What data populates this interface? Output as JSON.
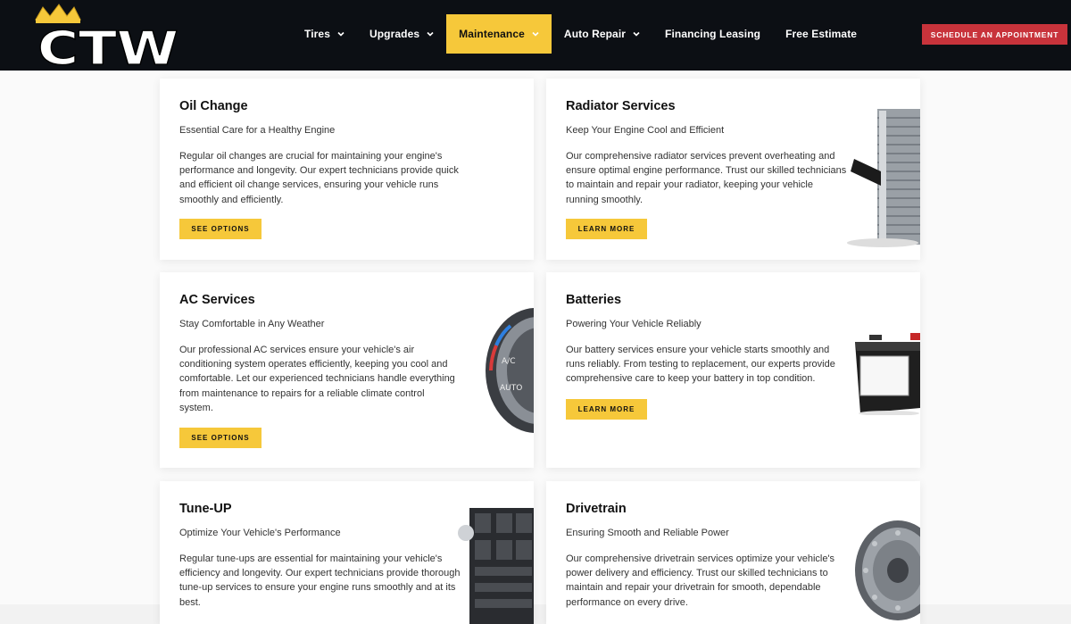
{
  "header": {
    "logo_text": "CTW",
    "nav": [
      {
        "label": "Tires",
        "dropdown": true
      },
      {
        "label": "Upgrades",
        "dropdown": true
      },
      {
        "label": "Maintenance",
        "dropdown": true,
        "active": true
      },
      {
        "label": "Auto Repair",
        "dropdown": true
      },
      {
        "label": "Financing Leasing",
        "dropdown": false
      },
      {
        "label": "Free Estimate",
        "dropdown": false
      }
    ],
    "cta_label": "SCHEDULE AN APPOINTMENT"
  },
  "colors": {
    "header_bg": "#0c0f14",
    "accent_yellow": "#f6c83a",
    "cta_red": "#c8333b"
  },
  "services": [
    {
      "title": "Oil Change",
      "subtitle": "Essential Care for a Healthy Engine",
      "description": "Regular oil changes are crucial for maintaining your engine's performance and longevity. Our expert technicians provide quick and efficient oil change services, ensuring your vehicle runs smoothly and efficiently.",
      "button": "SEE OPTIONS",
      "image_icon": "oil-bottle-icon"
    },
    {
      "title": "Radiator Services",
      "subtitle": "Keep Your Engine Cool and Efficient",
      "description": "Our comprehensive radiator services prevent overheating and ensure optimal engine performance. Trust our skilled technicians to maintain and repair your radiator, keeping your vehicle running smoothly.",
      "button": "LEARN MORE",
      "image_icon": "radiator-icon"
    },
    {
      "title": "AC Services",
      "subtitle": "Stay Comfortable in Any Weather",
      "description": "Our professional AC services ensure your vehicle's air conditioning system operates efficiently, keeping you cool and comfortable. Let our experienced technicians handle everything from maintenance to repairs for a reliable climate control system.",
      "button": "SEE OPTIONS",
      "image_icon": "ac-control-knob-icon",
      "knob_labels": [
        "A/C",
        "AUTO"
      ]
    },
    {
      "title": "Batteries",
      "subtitle": "Powering Your Vehicle Reliably",
      "description": "Our battery services ensure your vehicle starts smoothly and runs reliably. From testing to replacement, our experts provide comprehensive care to keep your battery in top condition.",
      "button": "LEARN MORE",
      "image_icon": "car-battery-icon"
    },
    {
      "title": "Tune-UP",
      "subtitle": "Optimize Your Vehicle's Performance",
      "description": "Regular tune-ups are essential for maintaining your vehicle's efficiency and longevity. Our expert technicians provide thorough tune-up services to ensure your engine runs smoothly and at its best.",
      "button": "SEE OPTIONS",
      "image_icon": "engine-icon"
    },
    {
      "title": "Drivetrain",
      "subtitle": "Ensuring Smooth and Reliable Power",
      "description": "Our comprehensive drivetrain services optimize your vehicle's power delivery and efficiency. Trust our skilled technicians to maintain and repair your drivetrain for smooth, dependable performance on every drive.",
      "button": "LEARN MORE",
      "image_icon": "torque-converter-icon"
    }
  ]
}
